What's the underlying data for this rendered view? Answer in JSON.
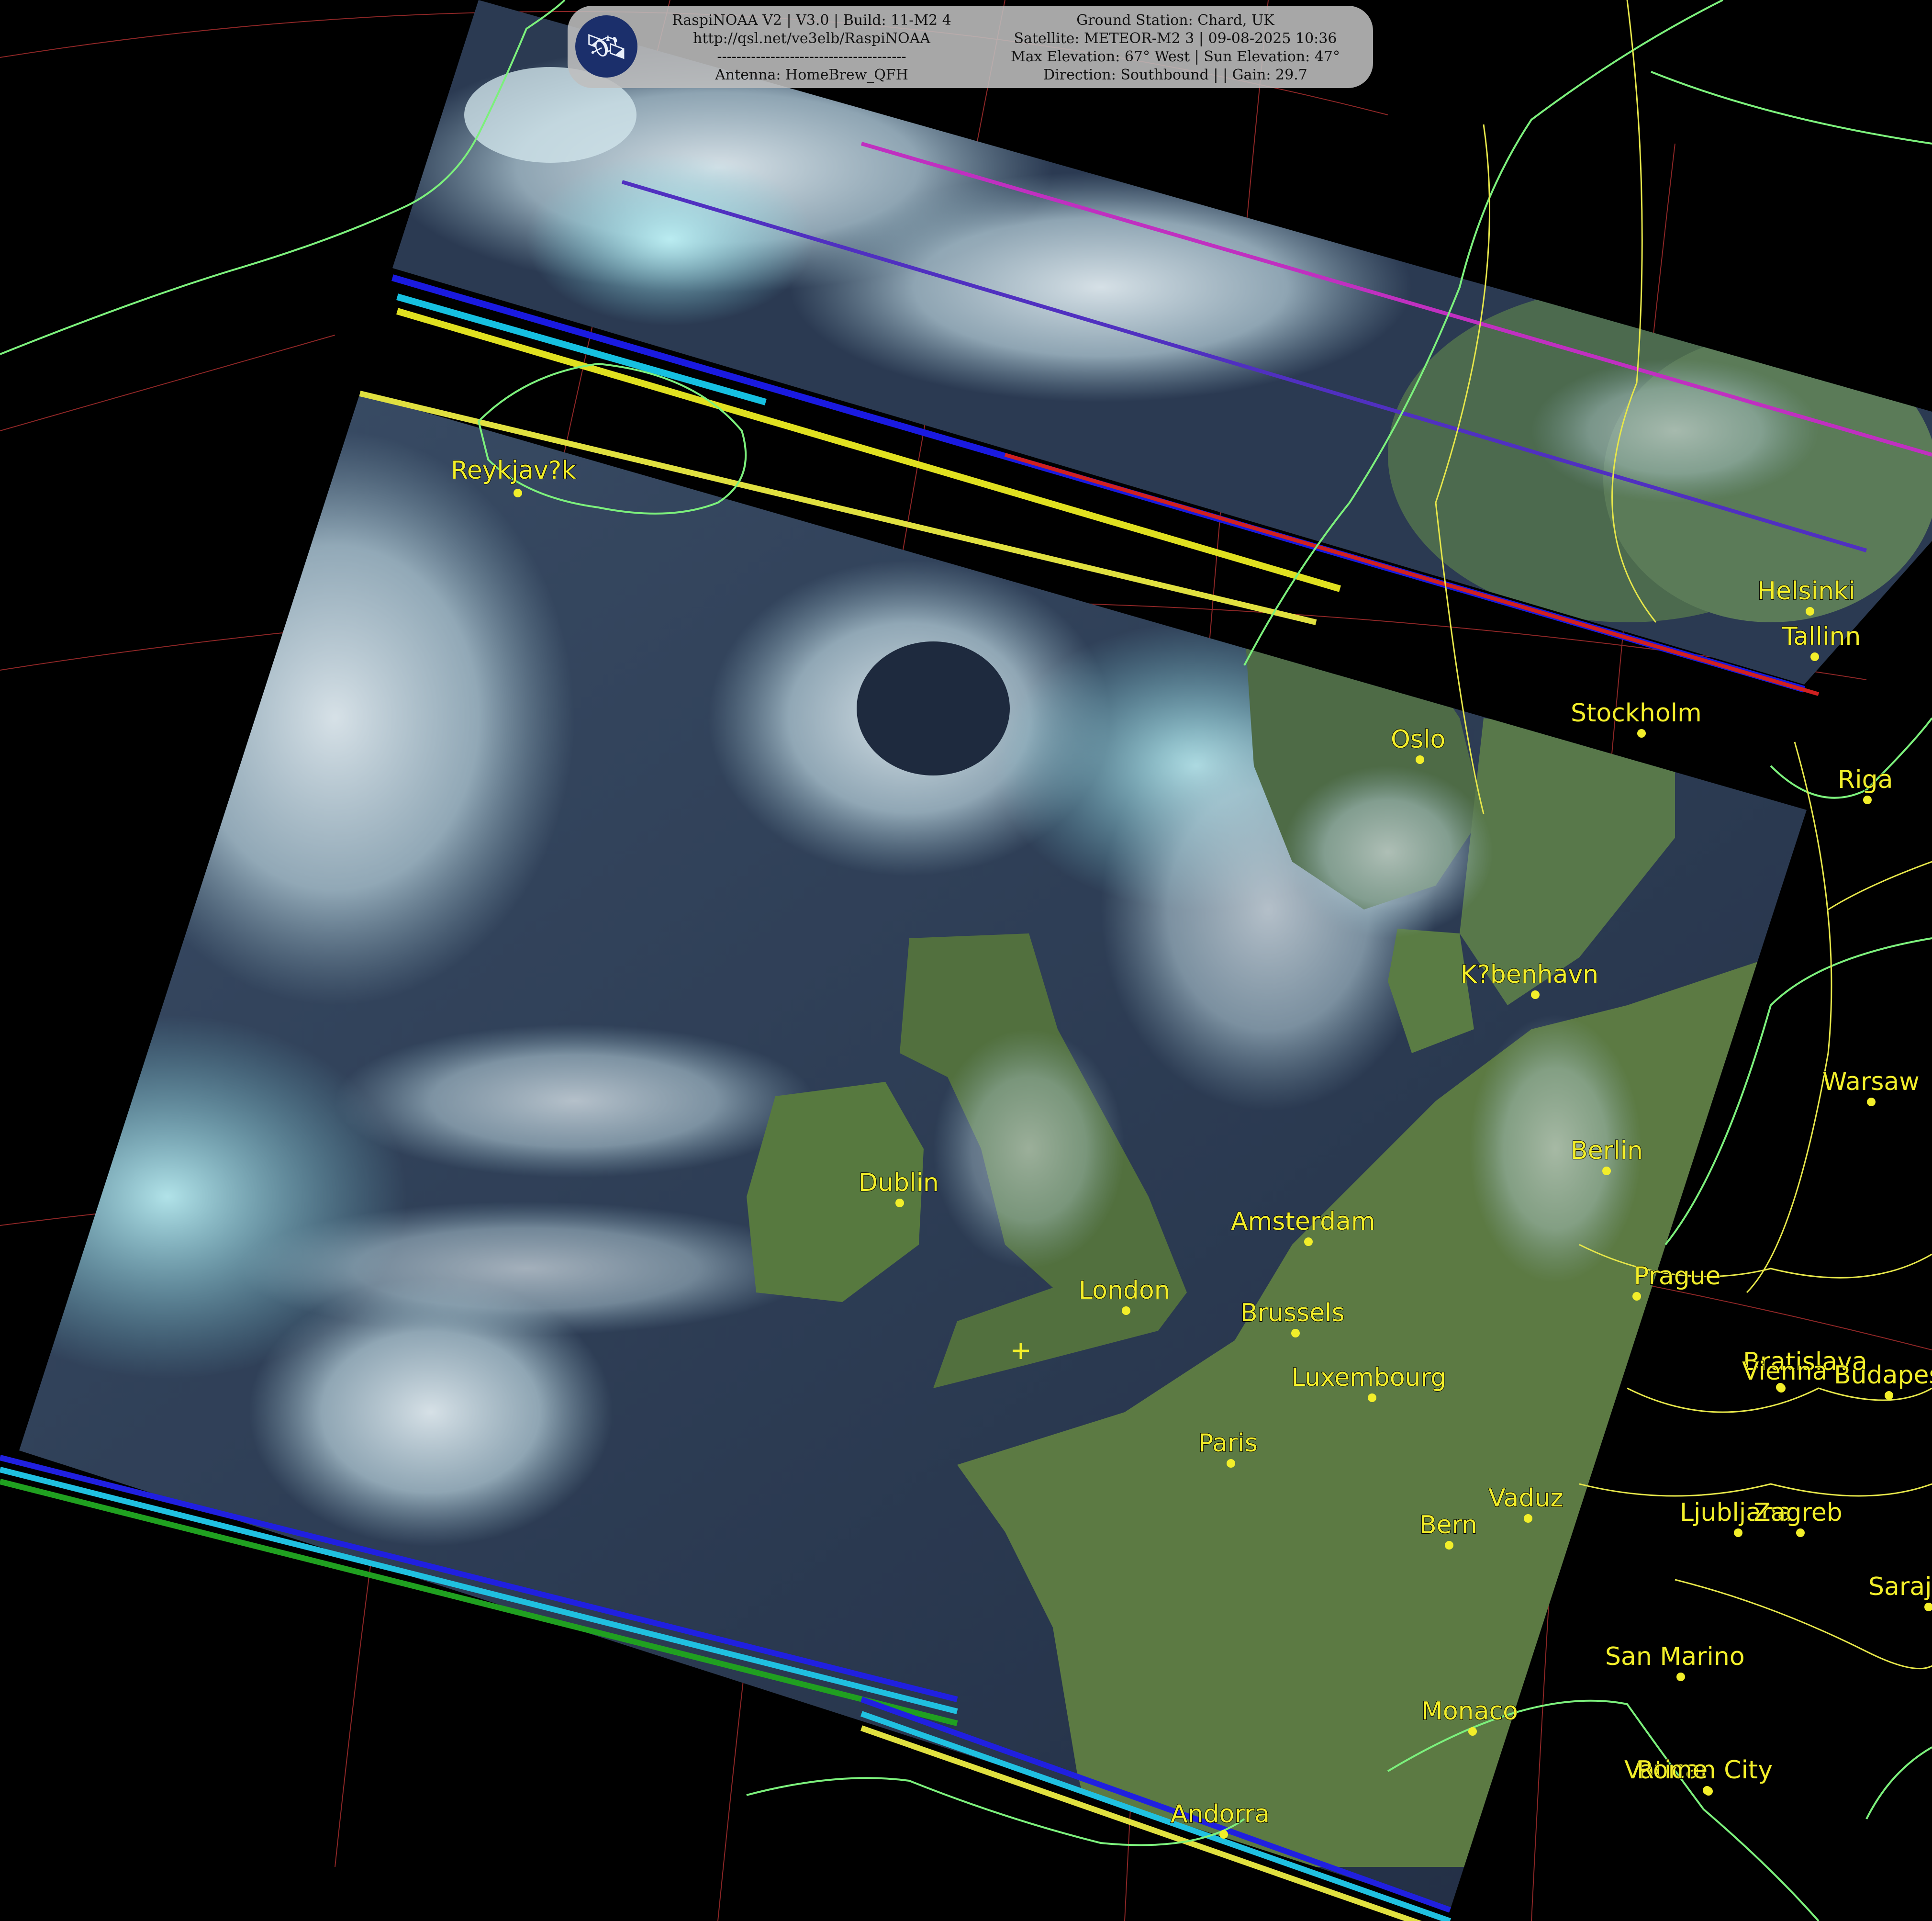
{
  "header": {
    "left_lines": [
      "RaspiNOAA V2 | V3.0 | Build: 11-M2 4",
      "http://qsl.net/ve3elb/RaspiNOAA",
      "---------------------------------------",
      "Antenna: HomeBrew_QFH"
    ],
    "right_lines": [
      "Ground Station: Chard, UK",
      "Satellite: METEOR-M2 3 | 09-08-2025 10:36",
      "Max Elevation: 67° West | Sun Elevation: 47°",
      "Direction: Southbound | | Gain: 29.7"
    ],
    "logo_icon": "satellite-icon"
  },
  "cities": [
    {
      "name": "Reykjav?k"
    },
    {
      "name": "Helsinki"
    },
    {
      "name": "Tallinn"
    },
    {
      "name": "Stockholm"
    },
    {
      "name": "Oslo"
    },
    {
      "name": "Riga"
    },
    {
      "name": "K?benhavn"
    },
    {
      "name": "Warsaw"
    },
    {
      "name": "Berlin"
    },
    {
      "name": "Dublin"
    },
    {
      "name": "Amsterdam"
    },
    {
      "name": "London"
    },
    {
      "name": "Brussels"
    },
    {
      "name": "Prague"
    },
    {
      "name": "Luxembourg"
    },
    {
      "name": "Bratislava"
    },
    {
      "name": "Vienna"
    },
    {
      "name": "Budapest"
    },
    {
      "name": "Paris"
    },
    {
      "name": "Vaduz"
    },
    {
      "name": "Bern"
    },
    {
      "name": "Ljubljana"
    },
    {
      "name": "Zagreb"
    },
    {
      "name": "Sarajevo"
    },
    {
      "name": "San Marino"
    },
    {
      "name": "Monaco"
    },
    {
      "name": "Vatican City"
    },
    {
      "name": "Rome"
    },
    {
      "name": "Andorra"
    }
  ],
  "colors": {
    "background": "#000000",
    "coastline": "#7cf07c",
    "border": "#e6e64a",
    "graticule": "#b03030",
    "city": "#f2ee2a"
  }
}
